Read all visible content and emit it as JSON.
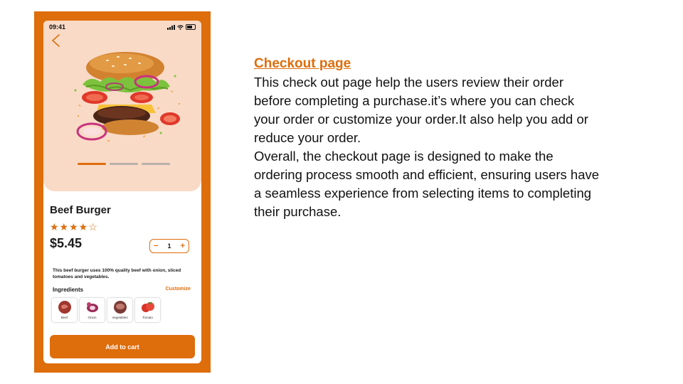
{
  "phone": {
    "status_time": "09:41",
    "product": {
      "title": "Beef Burger",
      "rating_stars": "★★★★☆",
      "rating": 4.5,
      "price": "$5.45",
      "quantity": "1",
      "description": "This beef burger uses 100% quality beef with onion, sliced tomatoes and vegetables."
    },
    "carousel": {
      "pages": 3,
      "active": 0
    },
    "ingredients": {
      "label": "Ingredients",
      "customize_label": "Customize",
      "items": [
        {
          "name": "Beef",
          "icon": "beef-icon",
          "color": "#a0372e"
        },
        {
          "name": "Onion",
          "icon": "onion-icon",
          "color": "#9c2d5a"
        },
        {
          "name": "Vegetables",
          "icon": "vegetables-icon",
          "color": "#7a3b36"
        },
        {
          "name": "Tomato",
          "icon": "tomato-icon",
          "color": "#d6342a"
        }
      ]
    },
    "add_to_cart_label": "Add to cart"
  },
  "slide": {
    "heading": "Checkout page",
    "paragraph1": "This check out page help the users review their order before completing a purchase.it’s where you can check your order or customize your order.It also help you add or reduce your order.",
    "paragraph2": "Overall, the checkout page is designed to make the ordering process smooth and efficient, ensuring users have a seamless experience from selecting items to completing their purchase."
  },
  "colors": {
    "accent": "#de6d0c",
    "hero_bg": "#f9dac6"
  }
}
